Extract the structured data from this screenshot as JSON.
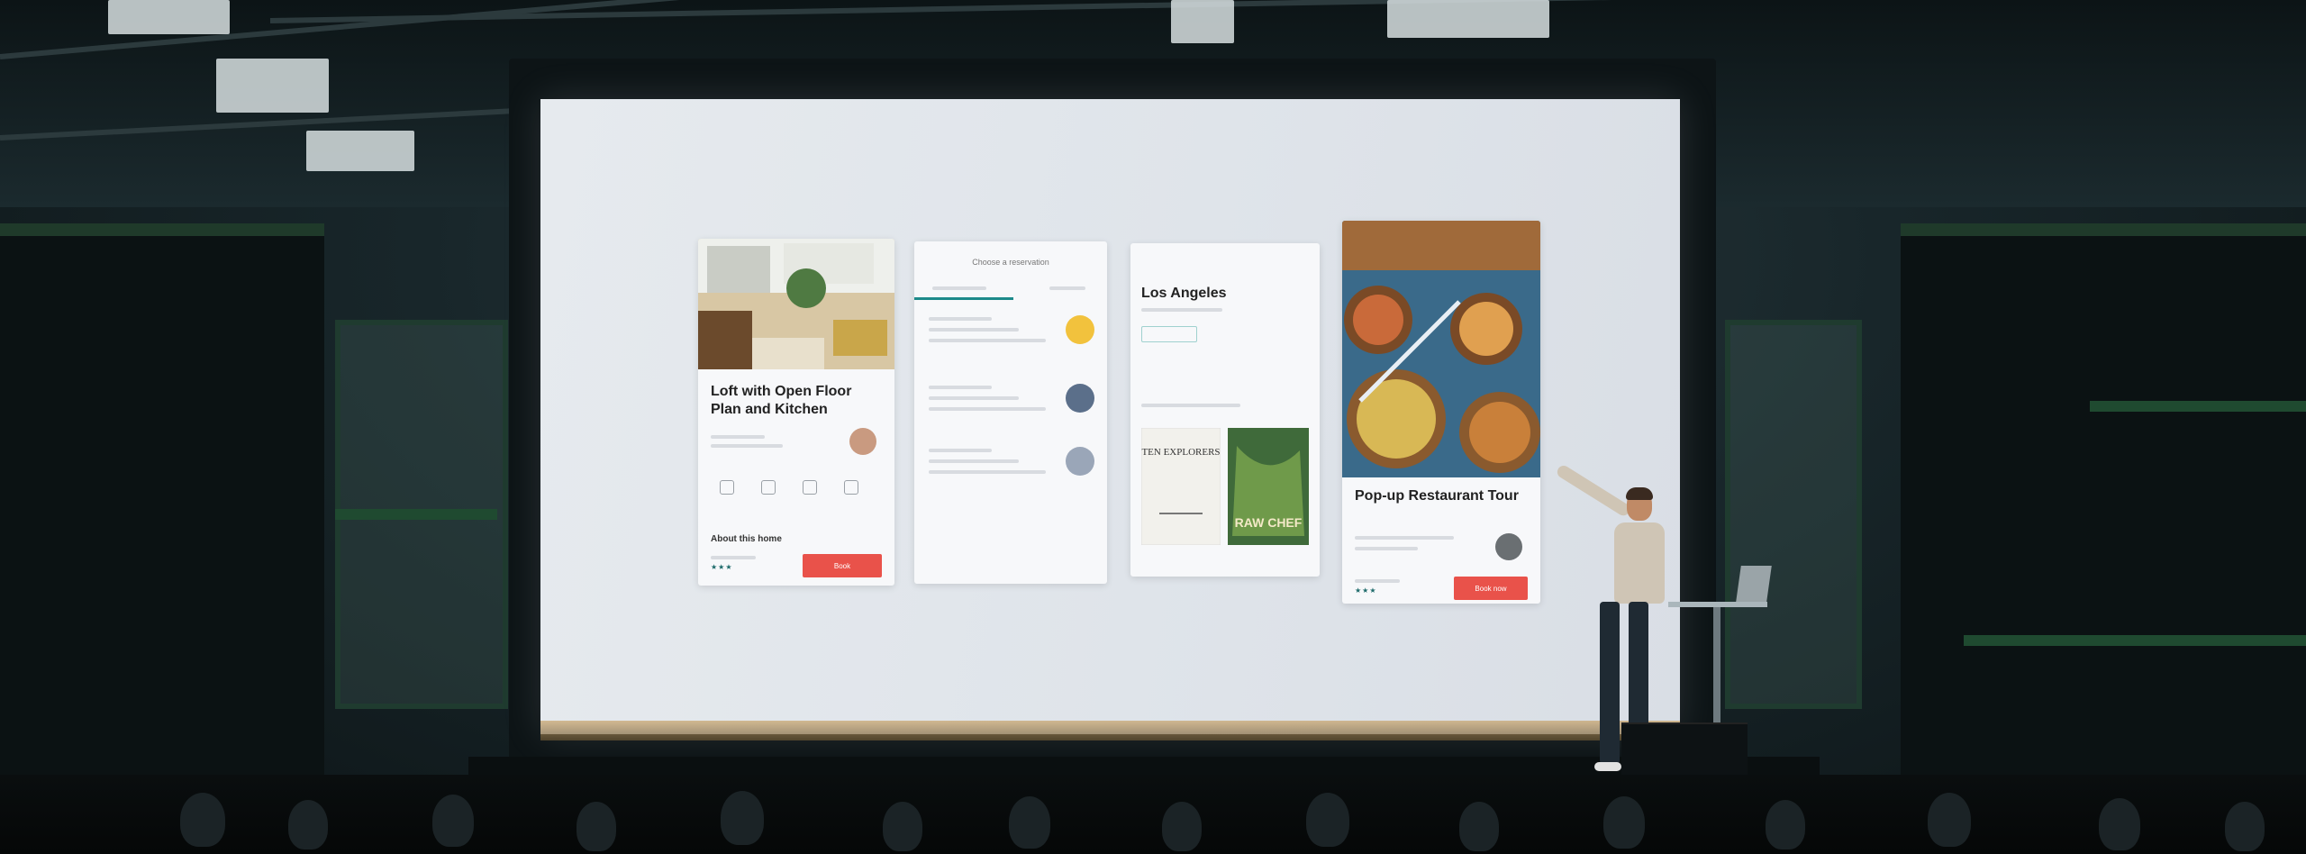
{
  "scene": {
    "setting": "Presenter on stage in front of projected mobile app mockups, audience in foreground"
  },
  "projection": {
    "card1": {
      "title": "Loft with Open Floor Plan and Kitchen",
      "section_label": "About this home",
      "button_label": "Book"
    },
    "card2": {
      "header": "Choose a reservation"
    },
    "card3": {
      "title": "Los Angeles",
      "book1_text": "TEN EXPLORERS",
      "book2_text": "RAW CHEF"
    },
    "card4": {
      "title": "Pop-up Restaurant Tour",
      "button_label": "Book now"
    }
  },
  "colors": {
    "accent_red": "#e9524a",
    "teal": "#1d6a6a",
    "screen_bg": "#e3e7eb"
  }
}
